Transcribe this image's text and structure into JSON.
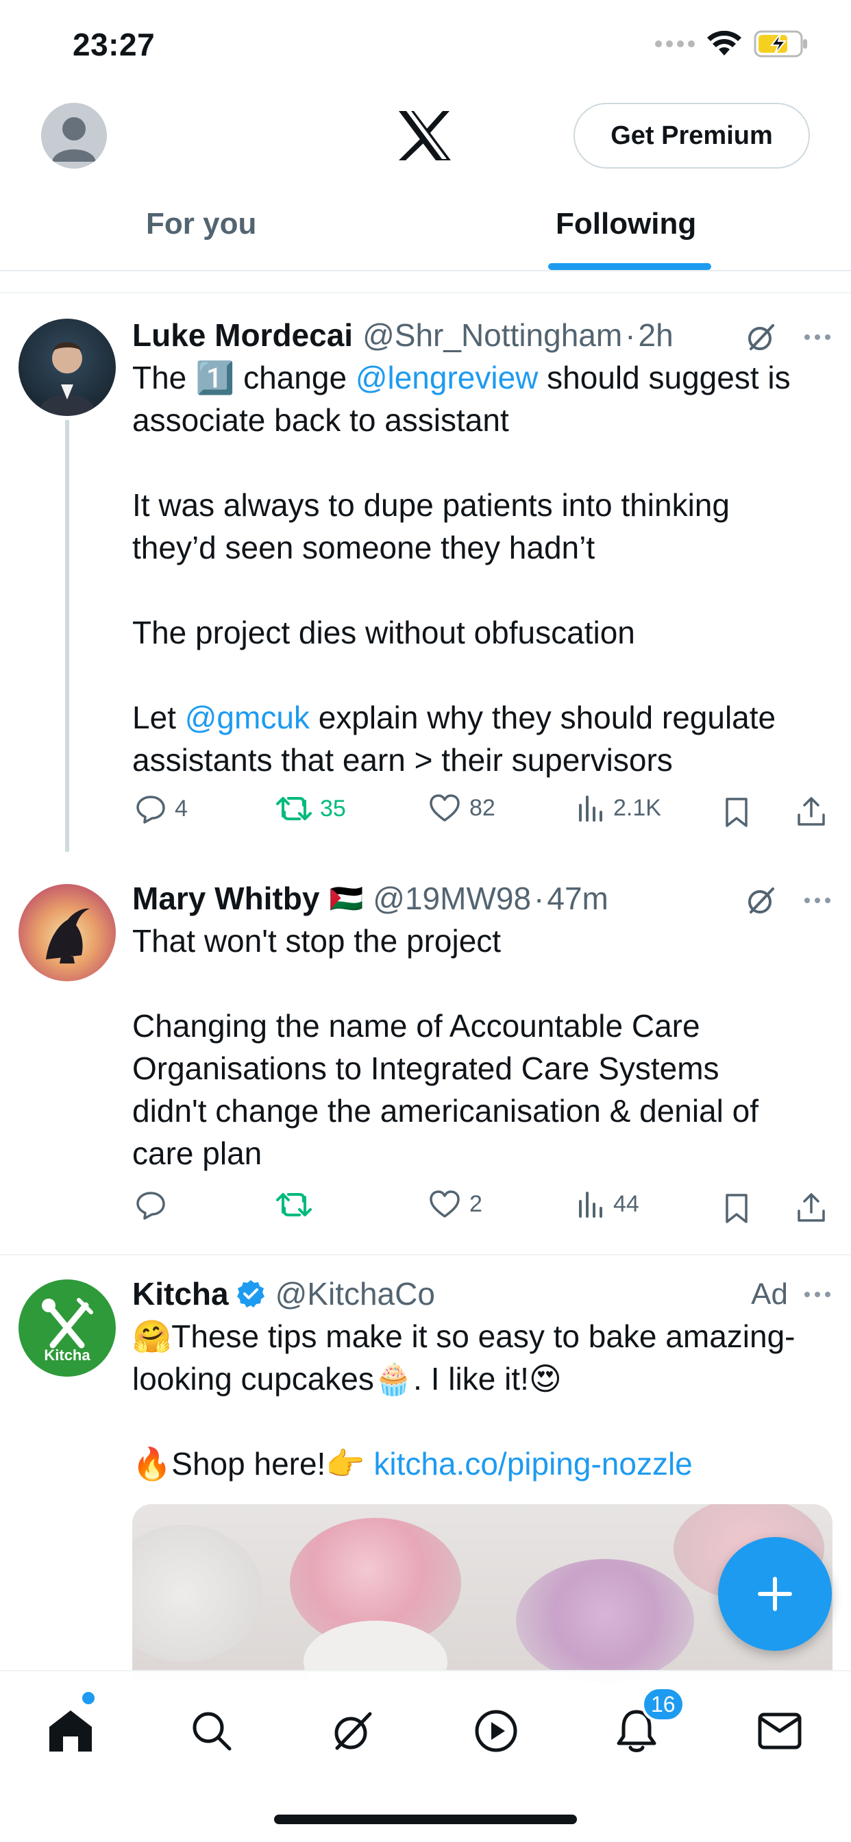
{
  "status_bar": {
    "time": "23:27"
  },
  "header": {
    "premium_label": "Get Premium"
  },
  "tabs": [
    {
      "label": "For you",
      "active": false
    },
    {
      "label": "Following",
      "active": true
    }
  ],
  "tweets": [
    {
      "name": "Luke Mordecai",
      "handle": "@Shr_Nottingham",
      "time": "2h",
      "lines": {
        "l1_a": "The ",
        "l1_emoji": "1️⃣",
        "l1_b": " change ",
        "l1_mention": "@lengreview",
        "l1_c": " should suggest is",
        "l2": "associate back to assistant",
        "p2": "It was always to dupe patients into thinking\nthey’d seen someone they hadn’t",
        "p3": "The project dies without obfuscation",
        "p4_a": "Let ",
        "p4_mention": "@gmcuk",
        "p4_b": " explain why they should regulate\nassistants that earn > their supervisors"
      },
      "replies": "4",
      "retweets": "35",
      "likes": "82",
      "views": "2.1K"
    },
    {
      "name": "Mary Whitby",
      "flag": "🇵🇸",
      "handle": "@19MW98",
      "time": "47m",
      "text": "That won't stop the project\n\nChanging the name of Accountable Care\nOrganisations to Integrated Care Systems\ndidn't change the americanisation & denial of\ncare plan",
      "replies": "",
      "retweets": "",
      "likes": "2",
      "views": "44"
    },
    {
      "name": "Kitcha",
      "handle": "@KitchaCo",
      "ad_label": "Ad",
      "avatar_text": "Kitcha",
      "line1": "🤗These tips make it so easy to bake amazing-",
      "line2": "looking cupcakes🧁. I like it!😍",
      "shop": "🔥Shop here!👉 ",
      "link": "kitcha.co/piping-nozzle"
    }
  ],
  "nav": {
    "notifications_count": "16"
  },
  "colors": {
    "accent": "#1d9bf0",
    "retweet_green": "#00ba7c",
    "secondary_text": "#536471"
  }
}
